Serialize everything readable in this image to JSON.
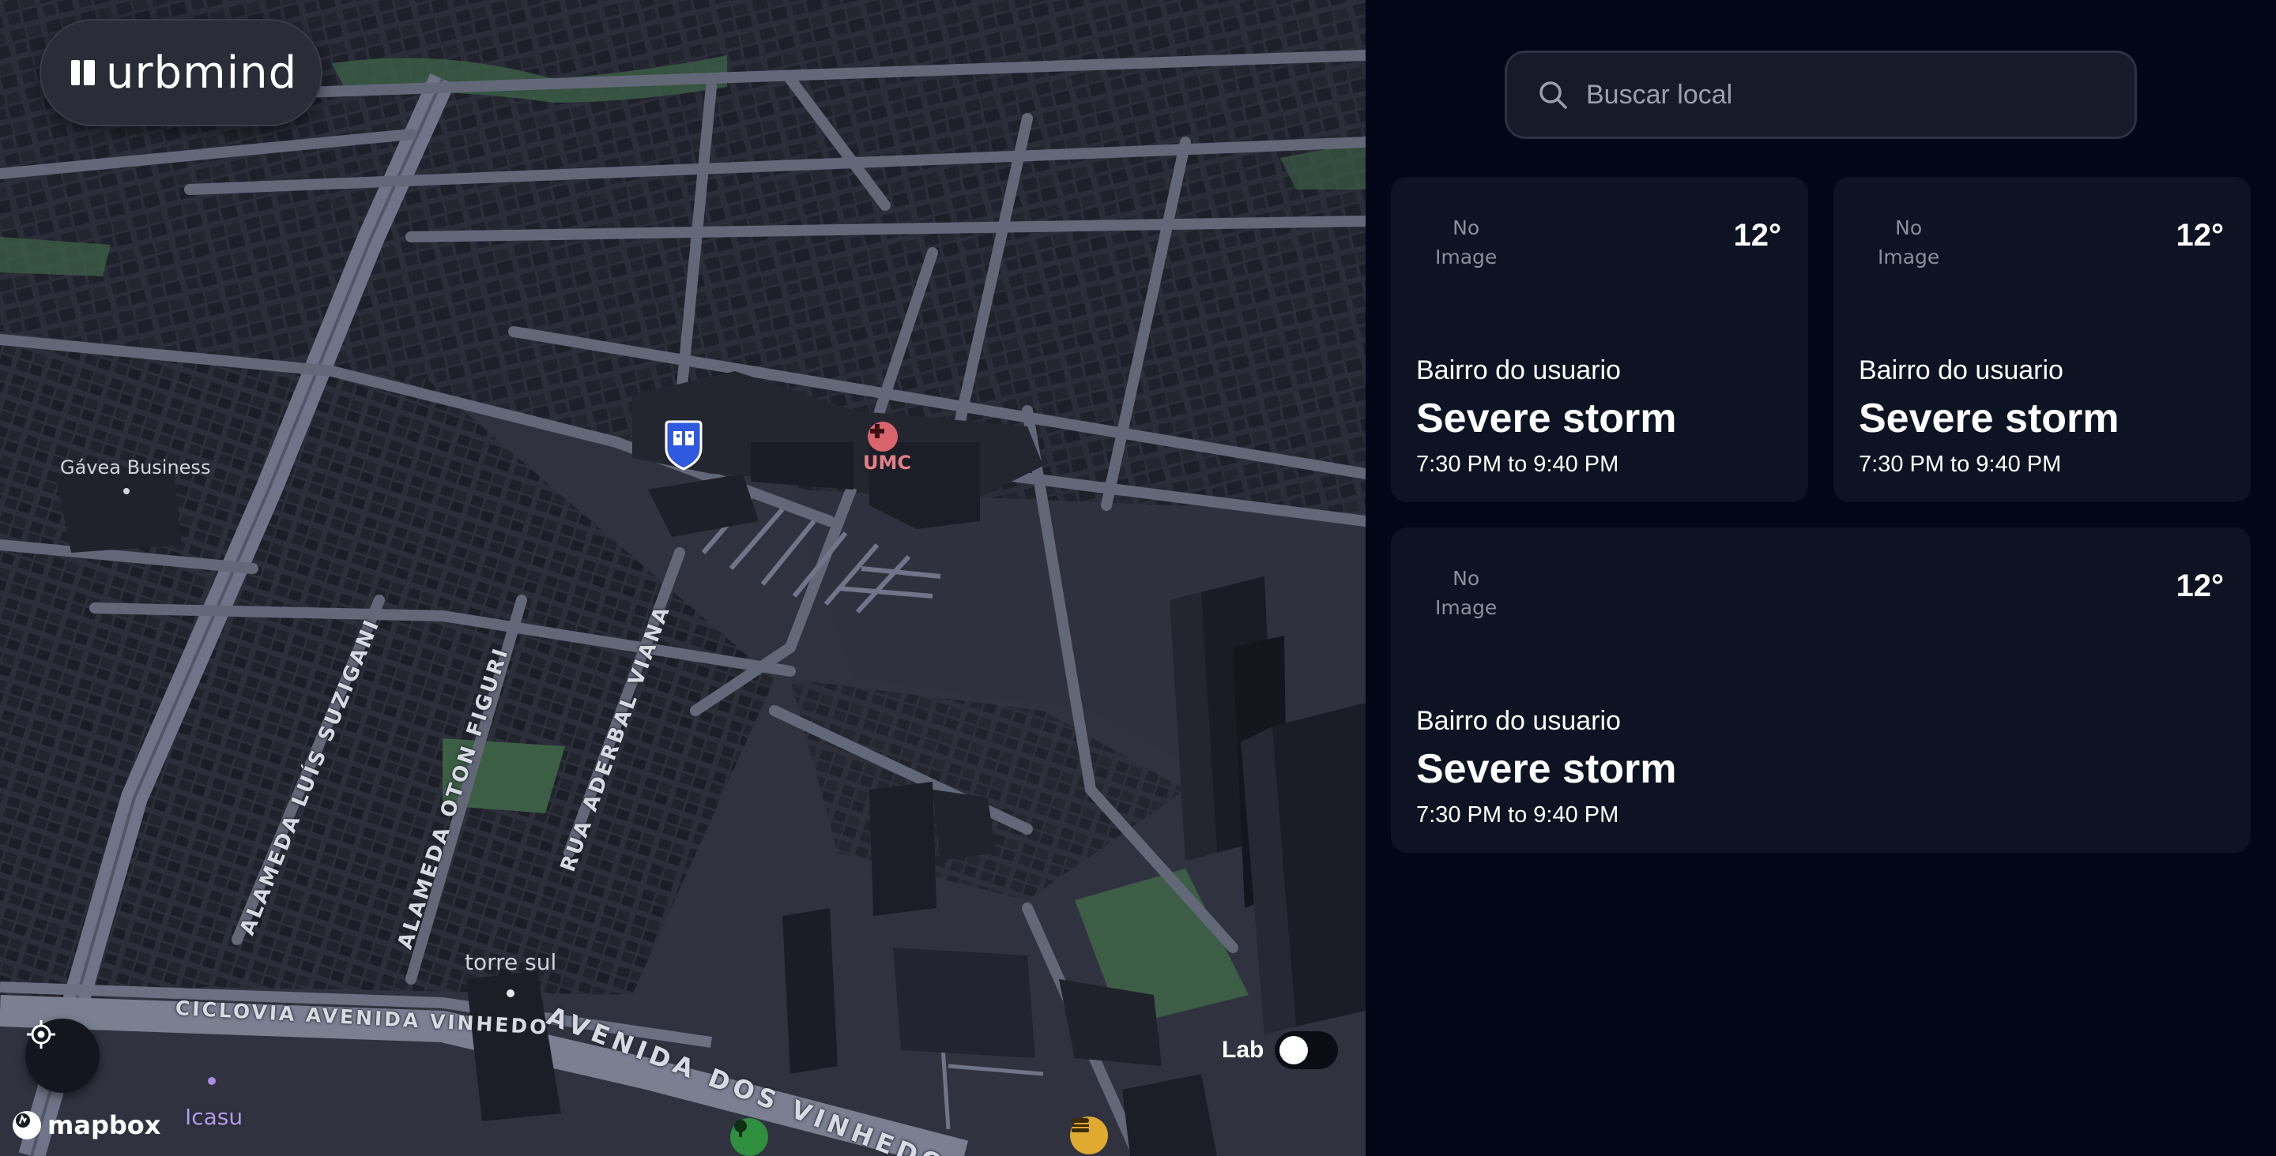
{
  "app": {
    "brand": "urbmind"
  },
  "map": {
    "streets": [
      "ALAMEDA LUÍS SUZIGANI",
      "ALAMEDA OTON FIGURI",
      "RUA ADERBAL VIANA",
      "CICLOVIA AVENIDA VINHEDO",
      "AVENIDA DOS VINHEDOS"
    ],
    "pois": {
      "gavea": "Gávea Business",
      "umc": "UMC",
      "torre": "torre sul",
      "icasu": "Icasu"
    },
    "attribution": "mapbox",
    "lab_label": "Lab",
    "lab_enabled": false
  },
  "search": {
    "placeholder": "Buscar local"
  },
  "cards": [
    {
      "image_placeholder_line1": "No",
      "image_placeholder_line2": "Image",
      "temperature": "12°",
      "place": "Bairro do usuario",
      "event": "Severe storm",
      "time": "7:30 PM to 9:40 PM"
    },
    {
      "image_placeholder_line1": "No",
      "image_placeholder_line2": "Image",
      "temperature": "12°",
      "place": "Bairro do usuario",
      "event": "Severe storm",
      "time": "7:30 PM to 9:40 PM"
    },
    {
      "image_placeholder_line1": "No",
      "image_placeholder_line2": "Image",
      "temperature": "12°",
      "place": "Bairro do usuario",
      "event": "Severe storm",
      "time": "7:30 PM to 9:40 PM"
    }
  ],
  "colors": {
    "map_ground": "#30323f",
    "map_road": "#6c7184",
    "panel_bg": "#020617",
    "card_bg": "#0d1322",
    "poi_hospital": "#e06c75",
    "poi_school": "#2f5ae0",
    "poi_park": "#2f8f3f",
    "poi_food": "#e0a92f",
    "poi_residential": "#8f6ad6"
  },
  "icons": [
    "search-icon",
    "locate-icon",
    "mapbox-logo-icon",
    "school-poi-icon",
    "hospital-poi-icon",
    "park-poi-icon",
    "restaurant-poi-icon"
  ]
}
